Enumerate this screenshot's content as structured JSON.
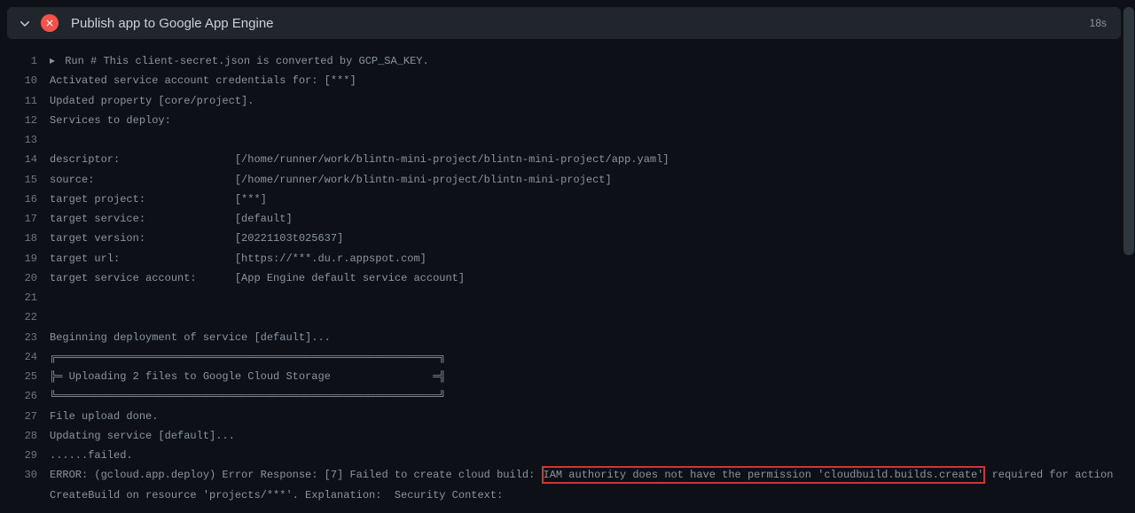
{
  "header": {
    "title": "Publish app to Google App Engine",
    "duration": "18s"
  },
  "log": {
    "lines": [
      {
        "n": "1",
        "prefix": "▸ ",
        "text": "Run # This client-secret.json is converted by GCP_SA_KEY."
      },
      {
        "n": "10",
        "prefix": "",
        "text": "Activated service account credentials for: [***]"
      },
      {
        "n": "11",
        "prefix": "",
        "text": "Updated property [core/project]."
      },
      {
        "n": "12",
        "prefix": "",
        "text": "Services to deploy:"
      },
      {
        "n": "13",
        "prefix": "",
        "text": ""
      },
      {
        "n": "14",
        "prefix": "",
        "text": "descriptor:                  [/home/runner/work/blintn-mini-project/blintn-mini-project/app.yaml]"
      },
      {
        "n": "15",
        "prefix": "",
        "text": "source:                      [/home/runner/work/blintn-mini-project/blintn-mini-project]"
      },
      {
        "n": "16",
        "prefix": "",
        "text": "target project:              [***]"
      },
      {
        "n": "17",
        "prefix": "",
        "text": "target service:              [default]"
      },
      {
        "n": "18",
        "prefix": "",
        "text": "target version:              [20221103t025637]"
      },
      {
        "n": "19",
        "prefix": "",
        "text": "target url:                  [https://***.du.r.appspot.com]"
      },
      {
        "n": "20",
        "prefix": "",
        "text": "target service account:      [App Engine default service account]"
      },
      {
        "n": "21",
        "prefix": "",
        "text": ""
      },
      {
        "n": "22",
        "prefix": "",
        "text": ""
      },
      {
        "n": "23",
        "prefix": "",
        "text": "Beginning deployment of service [default]..."
      },
      {
        "n": "24",
        "prefix": "",
        "text": "╔════════════════════════════════════════════════════════════╗"
      },
      {
        "n": "25",
        "prefix": "",
        "text": "╠═ Uploading 2 files to Google Cloud Storage                ═╣"
      },
      {
        "n": "26",
        "prefix": "",
        "text": "╚════════════════════════════════════════════════════════════╝"
      },
      {
        "n": "27",
        "prefix": "",
        "text": "File upload done."
      },
      {
        "n": "28",
        "prefix": "",
        "text": "Updating service [default]..."
      },
      {
        "n": "29",
        "prefix": "",
        "text": "......failed."
      }
    ],
    "error": {
      "n": "30",
      "before": "ERROR: (gcloud.app.deploy) Error Response: [7] Failed to create cloud build: ",
      "highlighted": "IAM authority does not have the permission 'cloudbuild.builds.create'",
      "after": " required for action CreateBuild on resource 'projects/***'. Explanation:  Security Context:"
    }
  }
}
